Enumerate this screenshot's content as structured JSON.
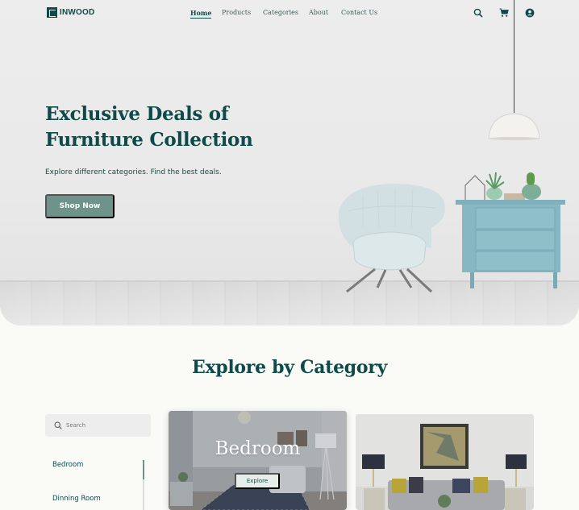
{
  "brand": {
    "name": "INWOOD"
  },
  "nav": {
    "items": [
      {
        "label": "Home",
        "active": true
      },
      {
        "label": "Products",
        "active": false
      },
      {
        "label": "Categories",
        "active": false
      },
      {
        "label": "About",
        "active": false
      },
      {
        "label": "Contact Us",
        "active": false
      }
    ],
    "icons": [
      "search-icon",
      "cart-icon",
      "account-icon"
    ]
  },
  "hero": {
    "title_line1": "Exclusive Deals of",
    "title_line2": "Furniture Collection",
    "subtitle": "Explore different categories. Find the best deals.",
    "cta_label": "Shop Now"
  },
  "categories_section": {
    "title": "Explore by Category",
    "search_placeholder": "Search",
    "list": [
      "Bedroom",
      "Dinning Room"
    ],
    "cards": [
      {
        "title": "Bedroom",
        "button_label": "Explore"
      },
      {
        "title": "",
        "button_label": ""
      }
    ]
  },
  "colors": {
    "primary": "#0f4a4a",
    "accent": "#6e938a",
    "background": "#fafaf7",
    "hero_bg": "#ececec",
    "cabinet": "#86b7c2"
  }
}
